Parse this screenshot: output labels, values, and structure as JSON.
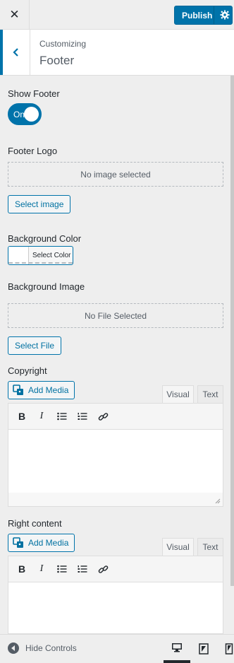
{
  "header": {
    "close_icon": "close-icon",
    "publish_label": "Publish",
    "settings_icon": "gear-icon"
  },
  "section": {
    "breadcrumb": "Customizing",
    "title": "Footer"
  },
  "controls": {
    "show_footer": {
      "label": "Show Footer",
      "toggle_text": "On",
      "value": true
    },
    "footer_logo": {
      "label": "Footer Logo",
      "placeholder": "No image selected",
      "button": "Select image"
    },
    "background_color": {
      "label": "Background Color",
      "button": "Select Color"
    },
    "background_image": {
      "label": "Background Image",
      "placeholder": "No File Selected",
      "button": "Select File"
    },
    "copyright": {
      "label": "Copyright",
      "add_media": "Add Media",
      "tab_visual": "Visual",
      "tab_text": "Text"
    },
    "right_content": {
      "label": "Right content",
      "add_media": "Add Media",
      "tab_visual": "Visual",
      "tab_text": "Text"
    }
  },
  "toolbar_icons": [
    "bold-icon",
    "italic-icon",
    "bullet-list-icon",
    "numbered-list-icon",
    "link-icon"
  ],
  "footer": {
    "hide_controls": "Hide Controls",
    "devices": [
      "desktop-icon",
      "tablet-icon",
      "mobile-icon"
    ],
    "active_device": "desktop"
  },
  "colors": {
    "accent": "#0073aa",
    "background": "#eeeeee"
  }
}
